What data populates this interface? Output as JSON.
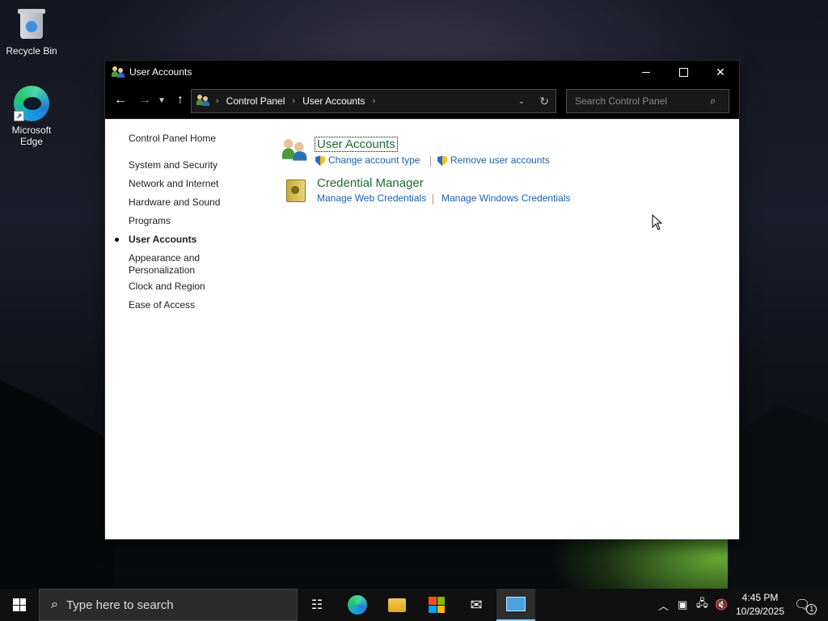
{
  "desktop": {
    "icons": [
      {
        "label": "Recycle Bin"
      },
      {
        "label": "Microsoft Edge"
      }
    ]
  },
  "window": {
    "title": "User Accounts",
    "minimize": "─",
    "maximize": "☐",
    "close": "✕"
  },
  "nav": {
    "back": "←",
    "forward": "→",
    "recent": "⌄",
    "up": "↑",
    "breadcrumb": [
      "Control Panel",
      "User Accounts"
    ],
    "refresh": "↻",
    "search_placeholder": "Search Control Panel"
  },
  "sidebar": {
    "home": "Control Panel Home",
    "items": [
      {
        "label": "System and Security"
      },
      {
        "label": "Network and Internet"
      },
      {
        "label": "Hardware and Sound"
      },
      {
        "label": "Programs"
      },
      {
        "label": "User Accounts"
      },
      {
        "label": "Appearance and Personalization"
      },
      {
        "label": "Clock and Region"
      },
      {
        "label": "Ease of Access"
      }
    ],
    "current_index": 4
  },
  "main": {
    "categories": [
      {
        "title": "User Accounts",
        "links": [
          "Change account type",
          "Remove user accounts"
        ]
      },
      {
        "title": "Credential Manager",
        "links": [
          "Manage Web Credentials",
          "Manage Windows Credentials"
        ]
      }
    ]
  },
  "taskbar": {
    "search_placeholder": "Type here to search",
    "pinned": [
      "task-view",
      "edge",
      "file-explorer",
      "store",
      "mail",
      "control-panel"
    ],
    "active": "control-panel",
    "time": "4:45 PM",
    "date": "10/29/2025",
    "notification_count": "1"
  },
  "colors": {
    "accent_link": "#1a5fb4",
    "category_title": "#1e6b2e",
    "titlebar": "#000000",
    "taskbar": "#101010"
  }
}
